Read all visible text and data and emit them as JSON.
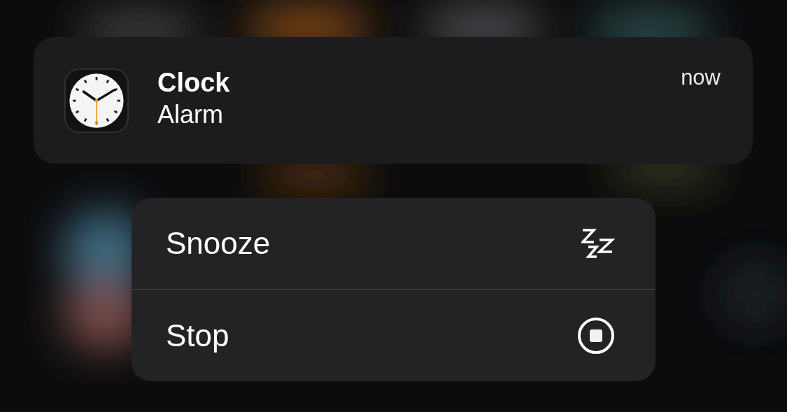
{
  "notification": {
    "app": "Clock",
    "message": "Alarm",
    "time": "now"
  },
  "actions": [
    {
      "label": "Snooze",
      "kind": "snooze"
    },
    {
      "label": "Stop",
      "kind": "stop"
    }
  ]
}
